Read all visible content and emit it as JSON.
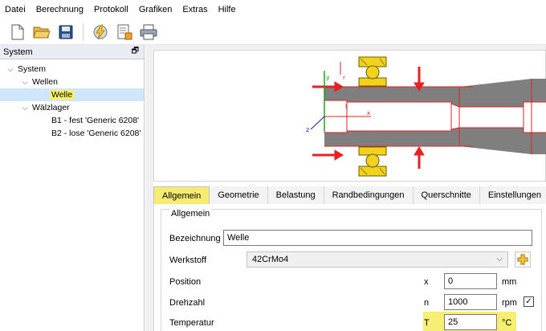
{
  "menu": [
    "Datei",
    "Berechnung",
    "Protokoll",
    "Grafiken",
    "Extras",
    "Hilfe"
  ],
  "toolbar": {
    "icons": [
      "new-file-icon",
      "open-folder-icon",
      "save-disk-icon",
      "calculate-lightning-icon",
      "report-icon",
      "print-icon"
    ]
  },
  "panel": {
    "title": "System",
    "float_icon": "🗗"
  },
  "tree": {
    "root": "System",
    "wellen": "Wellen",
    "welle": "Welle",
    "waelzlager": "Wälzlager",
    "b1": "B1 - fest 'Generic 6208'",
    "b2": "B2 - lose 'Generic 6208'"
  },
  "graphics": {
    "axis_y": "y",
    "axis_z": "z",
    "axis_x": "x",
    "axis_r": "r",
    "axis_l": "l",
    "colors": {
      "shaft": "#7f7f7f",
      "outline": "#e02020",
      "bearing": "#f2d21a",
      "arrow": "#e82020",
      "axis_y": "#1aa31a",
      "axis_z": "#1a1ad0"
    }
  },
  "tabs": [
    "Allgemein",
    "Geometrie",
    "Belastung",
    "Randbedingungen",
    "Querschnitte",
    "Einstellungen"
  ],
  "active_tab": "Allgemein",
  "form": {
    "group_title": "Allgemein",
    "bezeichnung_label": "Bezeichnung",
    "bezeichnung_value": "Welle",
    "werkstoff_label": "Werkstoff",
    "werkstoff_value": "42CrMo4",
    "position_label": "Position",
    "position_symbol": "x",
    "position_value": "0",
    "position_unit": "mm",
    "drehzahl_label": "Drehzahl",
    "drehzahl_symbol": "n",
    "drehzahl_value": "1000",
    "drehzahl_unit": "rpm",
    "drehzahl_checked": true,
    "temperatur_label": "Temperatur",
    "temperatur_symbol": "T",
    "temperatur_value": "25",
    "temperatur_unit": "°C"
  }
}
